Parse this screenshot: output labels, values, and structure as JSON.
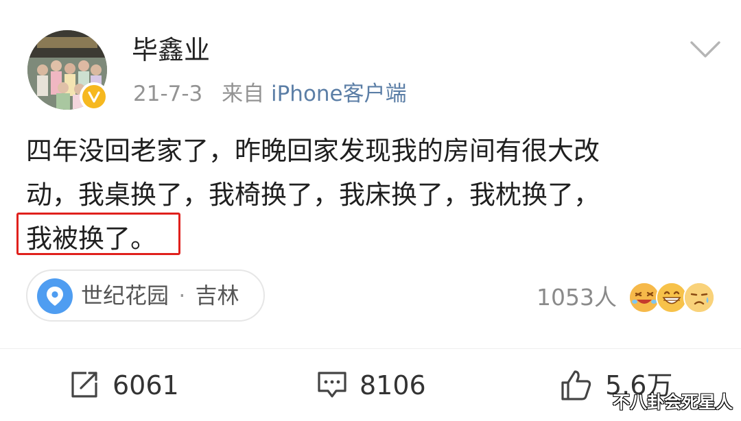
{
  "author": {
    "name": "毕鑫业",
    "verified": true,
    "badge_color": "#f6b81f"
  },
  "meta": {
    "date": "21-7-3",
    "from_label": "来自",
    "source": "iPhone客户端",
    "source_color": "#5b7ea6"
  },
  "post": {
    "lines": [
      "四年没回老家了，昨晚回家发现我的房间有很大改",
      "动，我桌换了，我椅换了，我床换了，我枕换了，",
      "我被换了。"
    ],
    "highlight_color": "#e0201c"
  },
  "location": {
    "icon": "location-pin-icon",
    "place": "世纪花园",
    "separator": "·",
    "city": "吉林",
    "icon_color": "#4f9df1"
  },
  "reactions": {
    "count_label": "1053人",
    "emojis": [
      "laughing-crying-emoji-icon",
      "grinning-emoji-icon",
      "tearful-emoji-icon"
    ]
  },
  "actions": {
    "repost": {
      "icon": "repost-icon",
      "count": "6061"
    },
    "comment": {
      "icon": "comment-icon",
      "count": "8106"
    },
    "like": {
      "icon": "thumbs-up-icon",
      "count": "5.6万"
    }
  },
  "watermark": "不八卦会死星人",
  "header": {
    "menu_icon": "chevron-down-icon"
  }
}
